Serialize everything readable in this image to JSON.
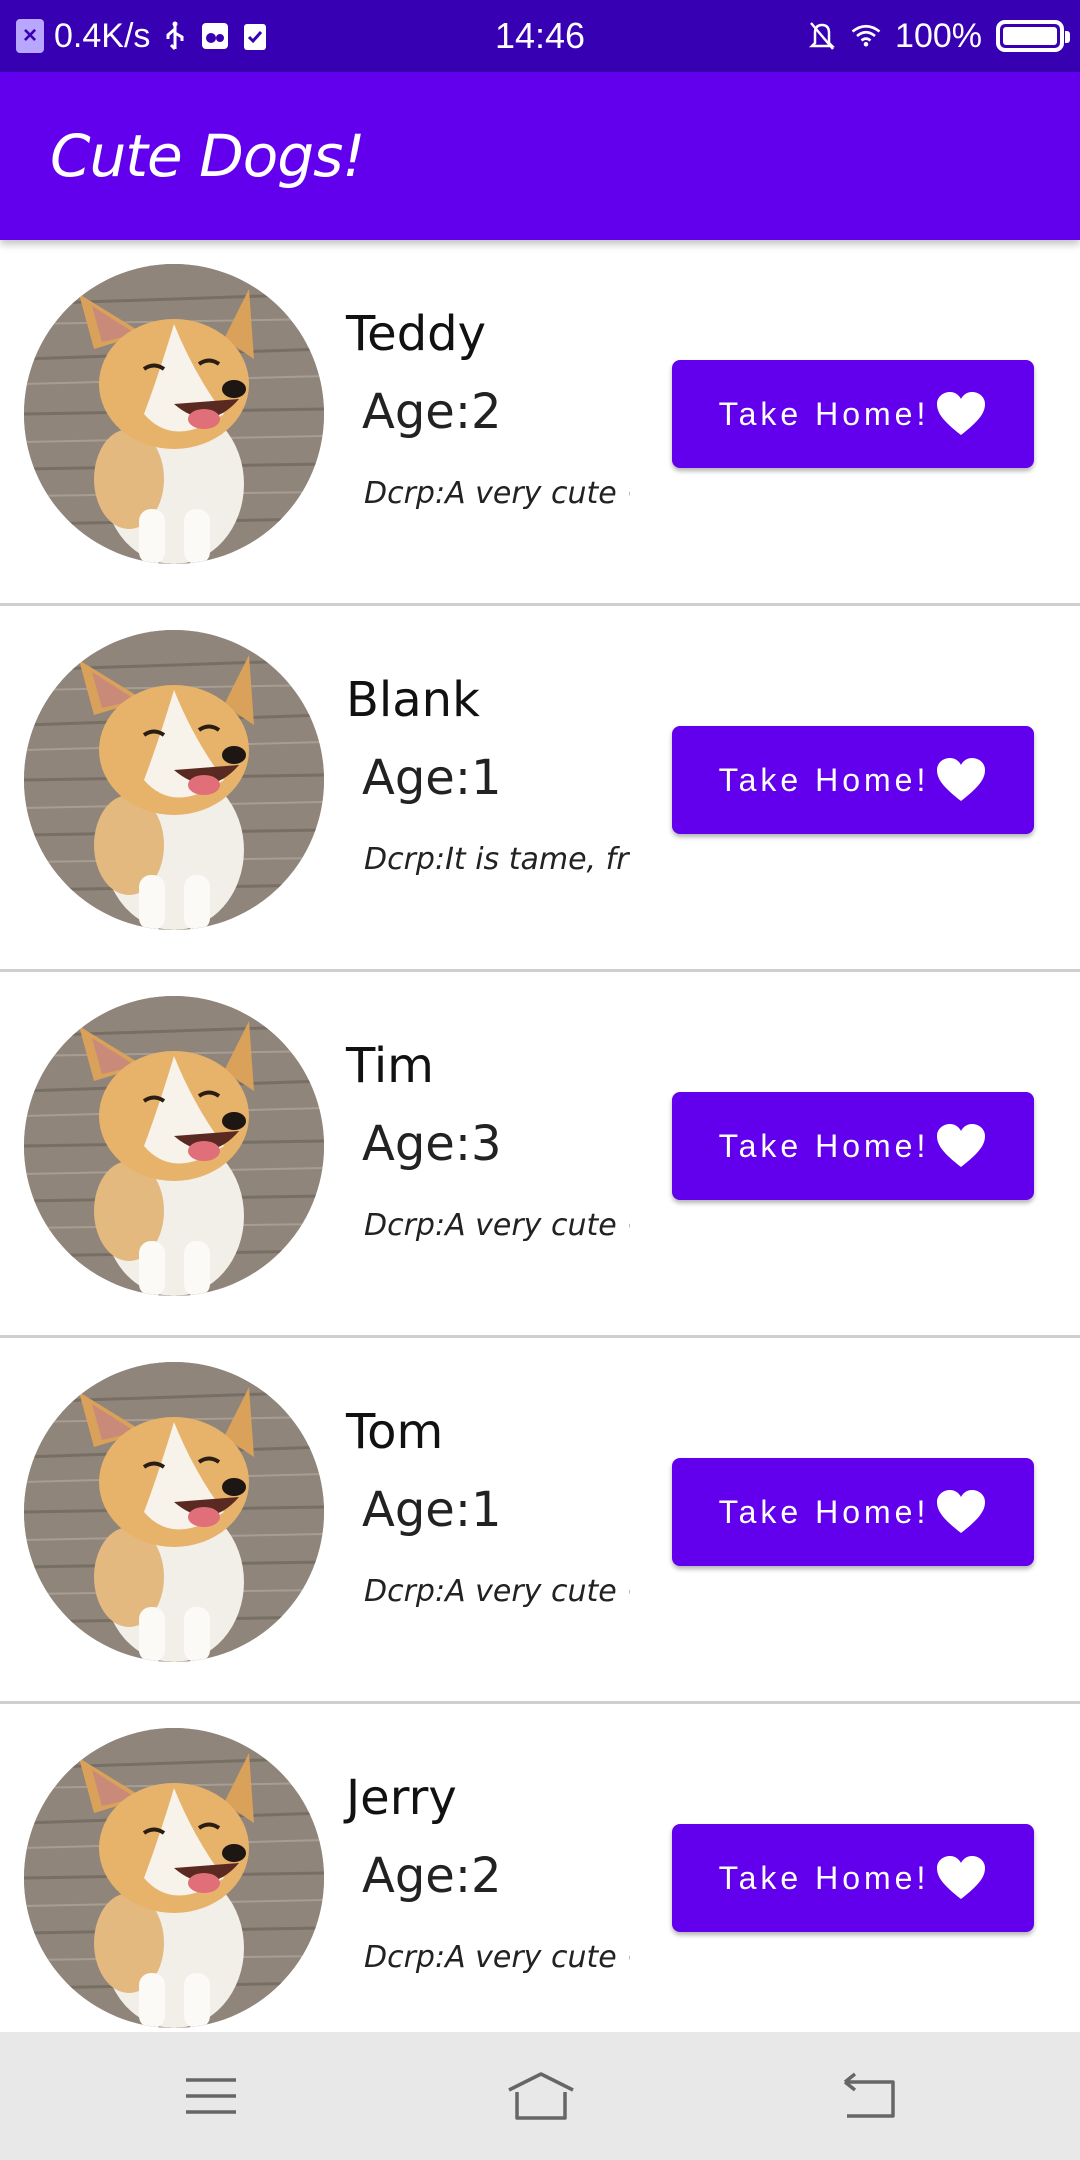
{
  "status_bar": {
    "net_speed": "0.4K/s",
    "time": "14:46",
    "battery": "100%",
    "icons": [
      "app-notification-icon",
      "usb-icon",
      "usb-debug-icon",
      "clipboard-check-icon",
      "bell-off-icon",
      "wifi-icon",
      "battery-icon"
    ]
  },
  "app_bar": {
    "title": "Cute Dogs!"
  },
  "dogs": [
    {
      "name": "Teddy",
      "age": "Age:2",
      "desc": "Dcrp:A very cute ⋯",
      "button": "Take Home!"
    },
    {
      "name": "Blank",
      "age": "Age:1",
      "desc": "Dcrp:It is tame, fr⋯",
      "button": "Take Home!"
    },
    {
      "name": "Tim",
      "age": "Age:3",
      "desc": "Dcrp:A very cute ⋯",
      "button": "Take Home!"
    },
    {
      "name": "Tom",
      "age": "Age:1",
      "desc": "Dcrp:A very cute ⋯",
      "button": "Take Home!"
    },
    {
      "name": "Jerry",
      "age": "Age:2",
      "desc": "Dcrp:A very cute ⋯",
      "button": "Take Home!"
    }
  ],
  "nav_bar": {
    "icons": [
      "menu-icon",
      "home-icon",
      "back-icon"
    ]
  },
  "colors": {
    "status_bar": "#3700b3",
    "primary": "#6200ee",
    "nav_bar": "#e8e8e8"
  }
}
